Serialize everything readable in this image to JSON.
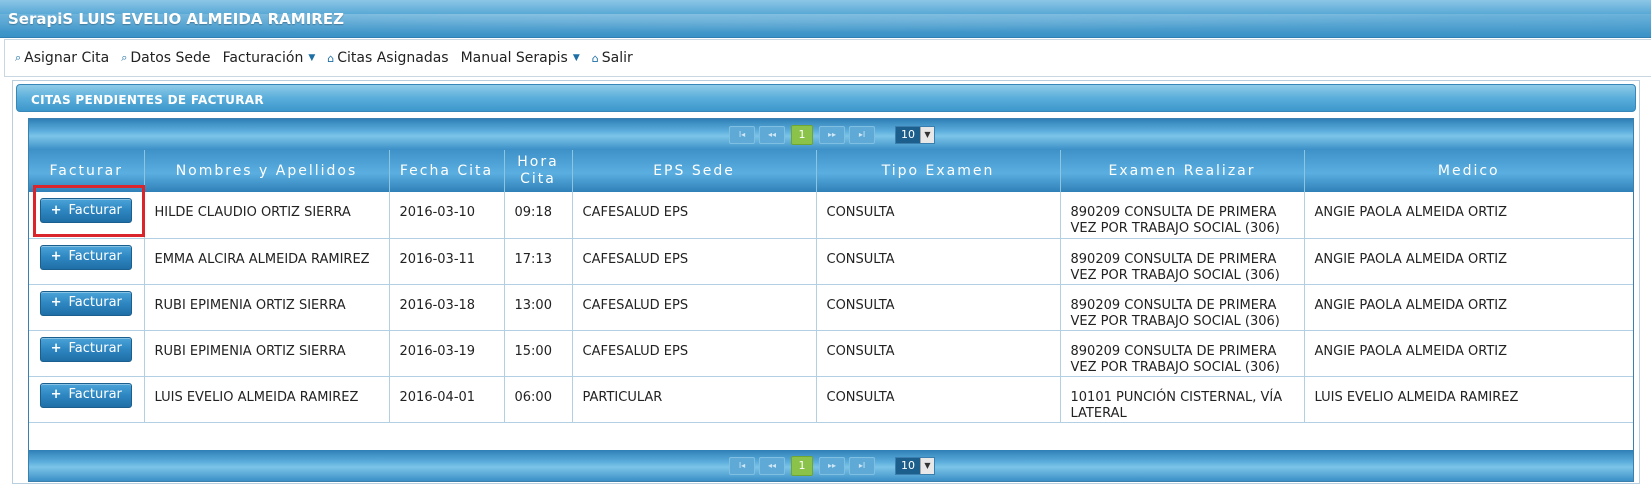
{
  "window": {
    "title": "SerapiS LUIS EVELIO ALMEIDA RAMIREZ"
  },
  "menu": [
    {
      "label": "Asignar Cita",
      "icon": "search-icon",
      "dropdown": false
    },
    {
      "label": "Datos Sede",
      "icon": "search-icon",
      "dropdown": false
    },
    {
      "label": "Facturación",
      "icon": "",
      "dropdown": true
    },
    {
      "label": "Citas Asignadas",
      "icon": "home-icon",
      "dropdown": false
    },
    {
      "label": "Manual Serapis",
      "icon": "",
      "dropdown": true
    },
    {
      "label": "Salir",
      "icon": "home-icon",
      "dropdown": false
    }
  ],
  "panel": {
    "title": "CITAS PENDIENTES DE FACTURAR"
  },
  "pager": {
    "first": "I◂",
    "prev": "◂◂",
    "page": "1",
    "next": "▸▸",
    "last": "▸I",
    "rows_per_page": "10"
  },
  "table": {
    "headers": [
      "Facturar",
      "Nombres y Apellidos",
      "Fecha Cita",
      "Hora Cita",
      "EPS Sede",
      "Tipo Examen",
      "Examen Realizar",
      "Medico"
    ],
    "button_label": "Facturar",
    "rows": [
      {
        "nombre": "HILDE CLAUDIO ORTIZ SIERRA",
        "fecha": "2016-03-10",
        "hora": "09:18",
        "eps": "CAFESALUD EPS",
        "tipo": "CONSULTA",
        "examen": "890209 CONSULTA DE PRIMERA VEZ POR TRABAJO SOCIAL (306)",
        "medico": "ANGIE PAOLA ALMEIDA ORTIZ"
      },
      {
        "nombre": "EMMA ALCIRA ALMEIDA RAMIREZ",
        "fecha": "2016-03-11",
        "hora": "17:13",
        "eps": "CAFESALUD EPS",
        "tipo": "CONSULTA",
        "examen": "890209 CONSULTA DE PRIMERA VEZ POR TRABAJO SOCIAL (306)",
        "medico": "ANGIE PAOLA ALMEIDA ORTIZ"
      },
      {
        "nombre": "RUBI EPIMENIA ORTIZ SIERRA",
        "fecha": "2016-03-18",
        "hora": "13:00",
        "eps": "CAFESALUD EPS",
        "tipo": "CONSULTA",
        "examen": "890209 CONSULTA DE PRIMERA VEZ POR TRABAJO SOCIAL (306)",
        "medico": "ANGIE PAOLA ALMEIDA ORTIZ"
      },
      {
        "nombre": "RUBI EPIMENIA ORTIZ SIERRA",
        "fecha": "2016-03-19",
        "hora": "15:00",
        "eps": "CAFESALUD EPS",
        "tipo": "CONSULTA",
        "examen": "890209 CONSULTA DE PRIMERA VEZ POR TRABAJO SOCIAL (306)",
        "medico": "ANGIE PAOLA ALMEIDA ORTIZ"
      },
      {
        "nombre": "LUIS EVELIO ALMEIDA RAMIREZ",
        "fecha": "2016-04-01",
        "hora": "06:00",
        "eps": "PARTICULAR",
        "tipo": "CONSULTA",
        "examen": "10101 PUNCIÓN CISTERNAL, VÍA LATERAL",
        "medico": "LUIS EVELIO ALMEIDA RAMIREZ"
      }
    ]
  },
  "colors": {
    "accent": "#3b92c6",
    "highlight": "#d9252b",
    "page_active": "#8bc34a"
  }
}
